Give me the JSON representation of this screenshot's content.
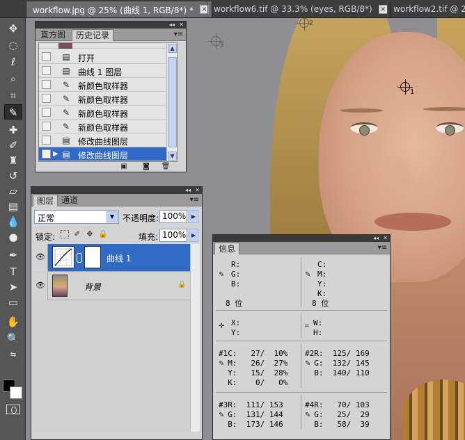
{
  "tabs": [
    {
      "label": "workflow.jpg @ 25% (曲线 1, RGB/8*) *",
      "active": true
    },
    {
      "label": "workflow6.tif @ 33.3% (eyes, RGB/8*)",
      "active": false
    },
    {
      "label": "workflow2.tif @ 25",
      "active": false
    }
  ],
  "tab_close_glyph": "×",
  "samplers": [
    "1",
    "2",
    "3"
  ],
  "history": {
    "tabs": [
      "直方图",
      "历史记录"
    ],
    "items": [
      {
        "label": "打开",
        "icon": "document-icon"
      },
      {
        "label": "曲线 1 图层",
        "icon": "document-icon"
      },
      {
        "label": "新颜色取样器",
        "icon": "color-sampler-icon"
      },
      {
        "label": "新颜色取样器",
        "icon": "color-sampler-icon"
      },
      {
        "label": "新颜色取样器",
        "icon": "color-sampler-icon"
      },
      {
        "label": "新颜色取样器",
        "icon": "color-sampler-icon"
      },
      {
        "label": "修改曲线图层",
        "icon": "document-icon"
      },
      {
        "label": "修改曲线图层",
        "icon": "document-icon",
        "selected": true
      }
    ]
  },
  "layers": {
    "tabs": [
      "图层",
      "通道"
    ],
    "blend_mode": "正常",
    "opacity_label": "不透明度:",
    "opacity_value": "100%",
    "lock_label": "锁定:",
    "fill_label": "填充:",
    "fill_value": "100%",
    "items": [
      {
        "name": "曲线 1",
        "selected": true
      },
      {
        "name": "背景",
        "selected": false
      }
    ]
  },
  "info": {
    "title": "信息",
    "rgb": {
      "r": "R:",
      "g": "G:",
      "b": "B:",
      "bits": "8 位"
    },
    "cmyk": {
      "c": "C:",
      "m": "M:",
      "y": "Y:",
      "k": "K:",
      "bits": "8 位"
    },
    "xy": {
      "x": "X:",
      "y": "Y:"
    },
    "wh": {
      "w": "W:",
      "h": "H:"
    },
    "s1": {
      "rows": [
        "#1C:   27/  10%",
        "  M:   26/  27%",
        "  Y:   15/  28%",
        "  K:    0/   0%"
      ]
    },
    "s2": {
      "rows": [
        "#2R:  125/ 169",
        "  G:  132/ 145",
        "  B:  140/ 110"
      ]
    },
    "s3": {
      "rows": [
        "#3R:  111/ 153",
        "  G:  131/ 144",
        "  B:  173/ 146"
      ]
    },
    "s4": {
      "rows": [
        "#4R:   70/ 103",
        "  G:   25/  29",
        "  B:   58/  39"
      ]
    }
  },
  "colors": {
    "selection": "#316ac5",
    "panel": "#d4d4d4",
    "toolbar": "#565656",
    "canvas_bg": "#8f8e93"
  }
}
